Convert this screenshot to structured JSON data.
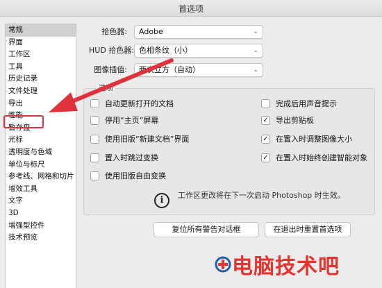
{
  "window": {
    "title": "首选项"
  },
  "sidebar": {
    "items": [
      {
        "label": "常规"
      },
      {
        "label": "界面"
      },
      {
        "label": "工作区"
      },
      {
        "label": "工具"
      },
      {
        "label": "历史记录"
      },
      {
        "label": "文件处理"
      },
      {
        "label": "导出"
      },
      {
        "label": "性能"
      },
      {
        "label": "暂存盘"
      },
      {
        "label": "光标"
      },
      {
        "label": "透明度与色域"
      },
      {
        "label": "单位与标尺"
      },
      {
        "label": "参考线、网格和切片"
      },
      {
        "label": "增效工具"
      },
      {
        "label": "文字"
      },
      {
        "label": "3D"
      },
      {
        "label": "增强型控件"
      },
      {
        "label": "技术预览"
      }
    ],
    "selected_index": 0,
    "highlighted_index": 7
  },
  "settings": {
    "color_picker": {
      "label": "拾色器:",
      "value": "Adobe"
    },
    "hud_color_picker": {
      "label": "HUD 拾色器:",
      "value": "色相条纹（小）"
    },
    "image_interpolation": {
      "label": "图像插值:",
      "value": "两次立方（自动）"
    }
  },
  "options": {
    "title": "选项",
    "checkboxes": [
      {
        "label": "自动更新打开的文档",
        "checked": false
      },
      {
        "label": "停用“主页”屏幕",
        "checked": false
      },
      {
        "label": "使用旧版“新建文档”界面",
        "checked": false
      },
      {
        "label": "置入时跳过变换",
        "checked": false
      },
      {
        "label": "使用旧版自由变换",
        "checked": false
      },
      {
        "label": "完成后用声音提示",
        "checked": false
      },
      {
        "label": "导出剪贴板",
        "checked": true
      },
      {
        "label": "在置入时调整图像大小",
        "checked": true
      },
      {
        "label": "在置入时始终创建智能对象",
        "checked": true
      }
    ],
    "check_glyph": "✓",
    "info_glyph": "i",
    "info_text": "工作区更改将在下一次启动 Photoshop 时生效。"
  },
  "buttons": {
    "reset_warnings": "复位所有警告对话框",
    "reset_prefs": "在退出时重置首选项"
  },
  "watermark": {
    "text": "电脑技术吧"
  },
  "colors": {
    "annotation_red": "#e0323c",
    "watermark_red": "#e3342f",
    "logo_blue": "#1e5fb4"
  }
}
